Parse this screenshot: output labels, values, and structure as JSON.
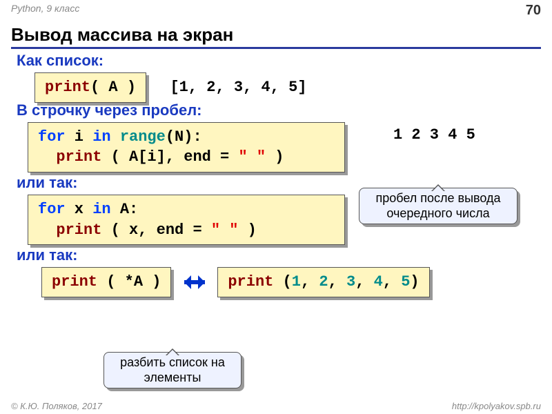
{
  "header": {
    "course": "Python, 9 класс",
    "page": "70"
  },
  "title": "Вывод массива на экран",
  "sections": {
    "as_list": {
      "label": "Как список:",
      "code_print": "print",
      "code_args": "( A )",
      "output": "[1, 2, 3, 4, 5]"
    },
    "as_row": {
      "label": "В строчку через пробел:"
    },
    "or1": "или так:",
    "or2": "или так:"
  },
  "code2": {
    "l1_for": "for",
    "l1_i": " i ",
    "l1_in": "in",
    "l1_range": " range",
    "l1_tail": "(N):",
    "l2_print": "print",
    "l2_mid": " ( A[i], end = ",
    "l2_str": "\" \"",
    "l2_end": " )"
  },
  "code3": {
    "l1_for": "for",
    "l1_x": " x ",
    "l1_in": "in",
    "l1_tail": " A:",
    "l2_print": "print",
    "l2_mid": " ( x, end = ",
    "l2_str": "\" \"",
    "l2_end": " )"
  },
  "outputs": {
    "row": "1 2 3 4 5"
  },
  "callouts": {
    "end_space": "пробел после вывода очередного числа",
    "star_a": "разбить список на элементы"
  },
  "bottom": {
    "left_print": "print",
    "left_args": " ( *A )",
    "right_print": "print",
    "right_open": " (",
    "right_close": ")",
    "nums": [
      "1",
      "2",
      "3",
      "4",
      "5"
    ]
  },
  "footer": {
    "copyright": "© К.Ю. Поляков, 2017",
    "url": "http://kpolyakov.spb.ru"
  }
}
